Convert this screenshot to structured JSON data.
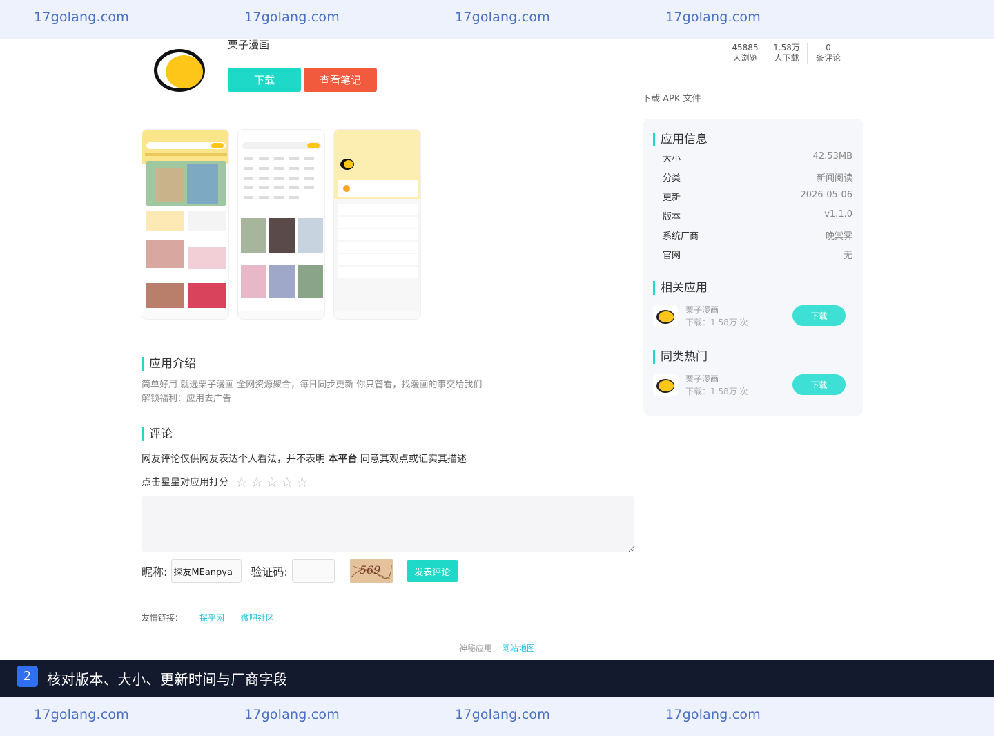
{
  "watermark": "17golang.com",
  "app": {
    "name": "栗子漫画",
    "download_label": "下载",
    "notes_label": "查看笔记",
    "stats": [
      {
        "value": "45885",
        "label": "人浏览"
      },
      {
        "value": "1.58万",
        "label": "人下载"
      },
      {
        "value": "0",
        "label": "条评论"
      }
    ],
    "apk_link": "下载 APK 文件"
  },
  "intro": {
    "heading": "应用介绍",
    "line1": "简单好用 就选栗子漫画 全网资源聚合，每日同步更新 你只管看，找漫画的事交给我们",
    "line2": "解锁福利：应用去广告"
  },
  "comments": {
    "heading": "评论",
    "note_prefix": "网友评论仅供网友表达个人看法，并不表明 ",
    "note_bold": "本平台",
    "note_suffix": " 同意其观点或证实其描述",
    "rate_label": "点击星星对应用打分",
    "stars": [
      "☆",
      "☆",
      "☆",
      "☆",
      "☆"
    ],
    "nick_label": "昵称:",
    "nick_value": "探友MEanpya",
    "code_label": "验证码:",
    "captcha_text": "569",
    "submit_label": "发表评论"
  },
  "friend_links": {
    "label": "友情链接：",
    "links": [
      "探乎网",
      "微吧社区"
    ]
  },
  "footer": {
    "links": [
      "神秘应用",
      "网站地图"
    ]
  },
  "sidebar": {
    "info_heading": "应用信息",
    "info": [
      {
        "k": "大小",
        "v": "42.53MB"
      },
      {
        "k": "分类",
        "v": "新闻阅读"
      },
      {
        "k": "更新",
        "v": "2026-05-06"
      },
      {
        "k": "版本",
        "v": "v1.1.0"
      },
      {
        "k": "系统厂商",
        "v": "晚棠霁"
      },
      {
        "k": "官网",
        "v": "无"
      }
    ],
    "related_heading": "相关应用",
    "related": {
      "name": "栗子漫画",
      "count": "下载：1.58万 次",
      "btn": "下载"
    },
    "hot_heading": "同类热门",
    "hot": {
      "name": "栗子漫画",
      "count": "下载：1.58万 次",
      "btn": "下载"
    }
  },
  "banner": {
    "step": "2",
    "text": "核对版本、大小、更新时间与厂商字段"
  },
  "colors": {
    "accent": "#1ed8c8",
    "note_button": "#f25a3e",
    "banner_bg": "#131a2e",
    "watermark": "#4a6fc7"
  }
}
